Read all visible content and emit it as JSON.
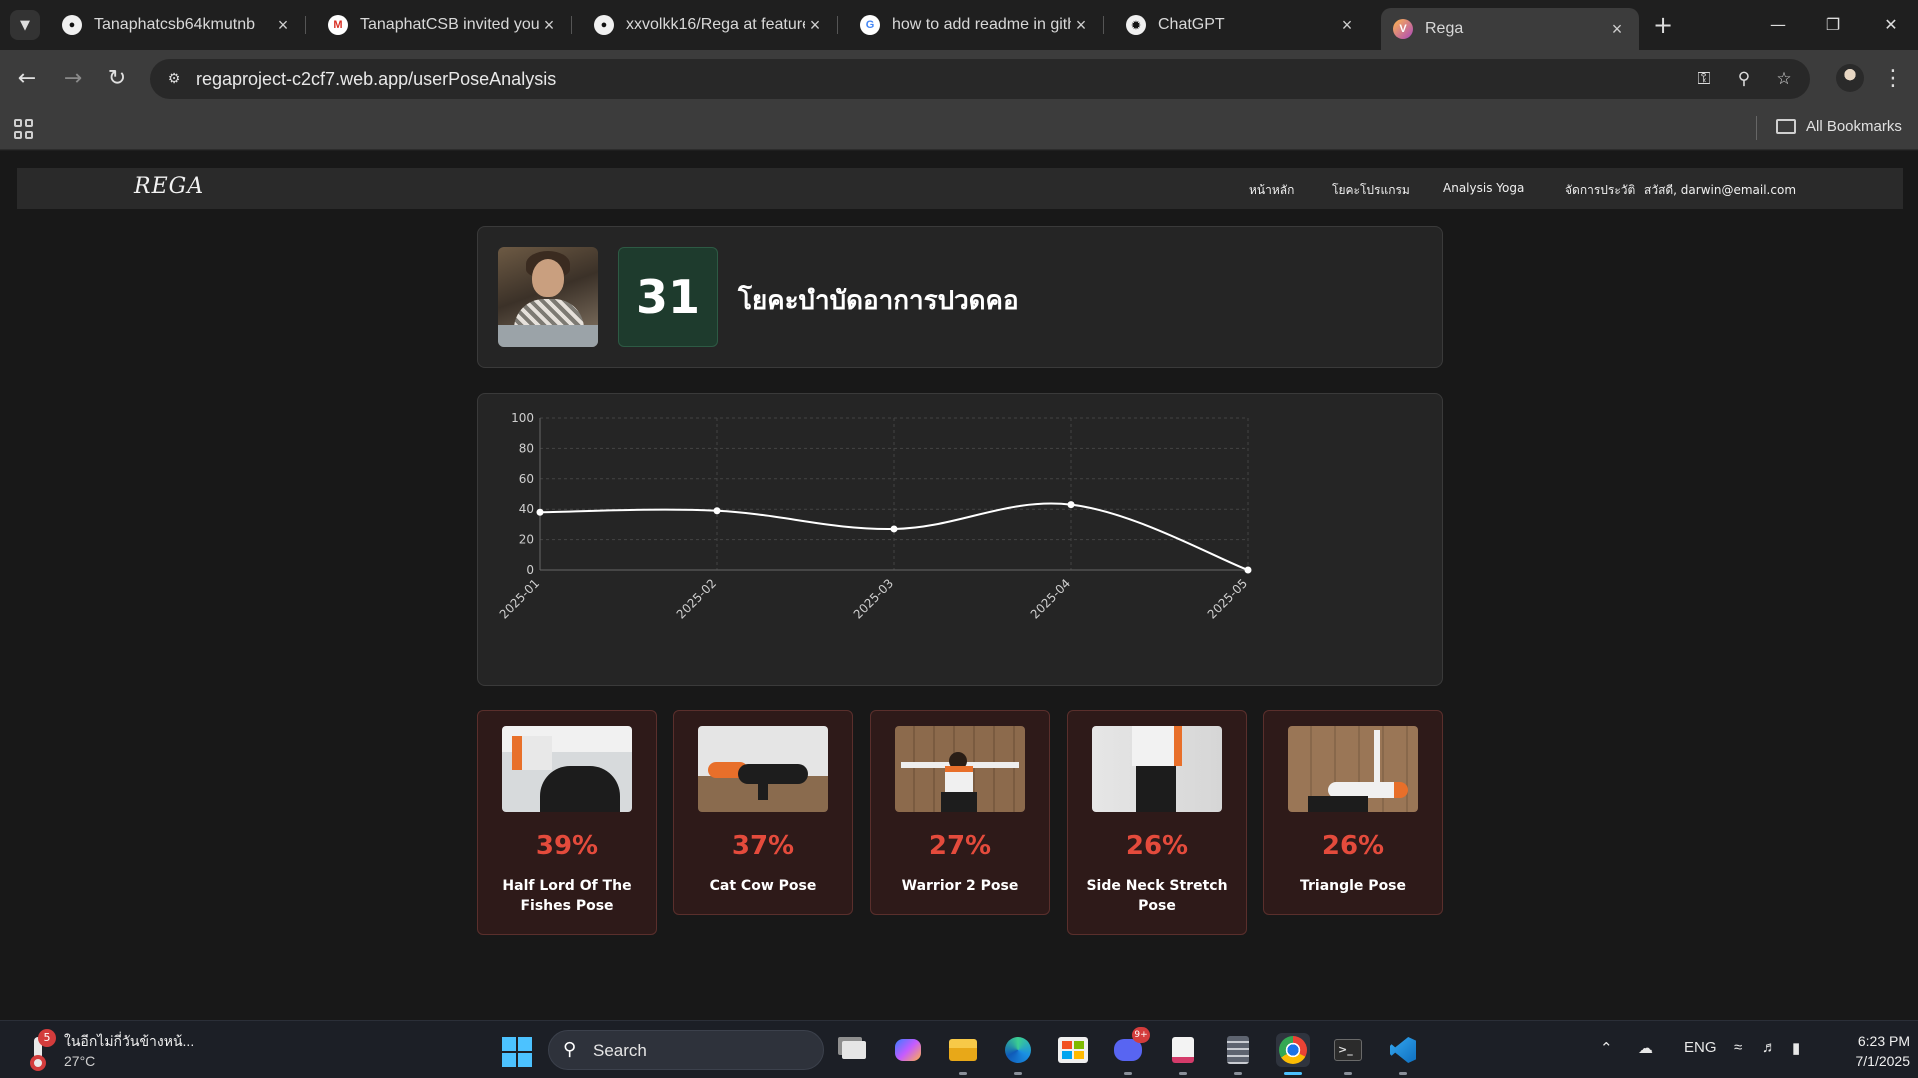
{
  "browser": {
    "tabs": [
      {
        "title": "Tanaphatcsb64kmutnb",
        "icon": "github-icon"
      },
      {
        "title": "TanaphatCSB invited you to",
        "icon": "gmail-icon"
      },
      {
        "title": "xxvolkk16/Rega at feature/",
        "icon": "github-icon"
      },
      {
        "title": "how to add readme in gith",
        "icon": "google-icon"
      },
      {
        "title": "ChatGPT",
        "icon": "chatgpt-icon"
      },
      {
        "title": "Rega",
        "icon": "rega-icon"
      }
    ],
    "url": "regaproject-c2cf7.web.app/userPoseAnalysis",
    "all_bookmarks": "All Bookmarks"
  },
  "site": {
    "logo": "REGA",
    "nav": [
      "หน้าหลัก",
      "โยคะโปรแกรม",
      "Analysis Yoga",
      "จัดการประวัติ",
      "สวัสดี, darwin@email.com"
    ]
  },
  "program": {
    "score": "31",
    "title": "โยคะบำบัดอาการปวดคอ"
  },
  "chart_data": {
    "type": "line",
    "categories": [
      "2025-01",
      "2025-02",
      "2025-03",
      "2025-04",
      "2025-05"
    ],
    "values": [
      38,
      39,
      27,
      43,
      0
    ],
    "ylim": [
      0,
      100
    ],
    "yticks": [
      "0",
      "20",
      "40",
      "60",
      "80",
      "100"
    ],
    "grid": true,
    "title": "",
    "xlabel": "",
    "ylabel": "",
    "colors": {
      "line": "#ffffff",
      "grid": "#444444",
      "axis": "#666666",
      "tick": "#cfcfcf"
    }
  },
  "poses": [
    {
      "percent": "39%",
      "name": "Half Lord Of The Fishes Pose"
    },
    {
      "percent": "37%",
      "name": "Cat Cow Pose"
    },
    {
      "percent": "27%",
      "name": "Warrior 2 Pose"
    },
    {
      "percent": "26%",
      "name": "Side Neck Stretch Pose"
    },
    {
      "percent": "26%",
      "name": "Triangle Pose"
    }
  ],
  "taskbar": {
    "weather_text": "ในอีกไม่กี่วันข้างหน้...",
    "weather_temp": "27°C",
    "weather_badge": "5",
    "search_label": "Search",
    "discord_badge": "9+",
    "lang": "ENG",
    "time": "6:23 PM",
    "date": "7/1/2025"
  },
  "colors": {
    "accent_green": "#1e3b2d",
    "pose_card_bg": "#2e1a19",
    "percent_red": "#e44b3c"
  }
}
